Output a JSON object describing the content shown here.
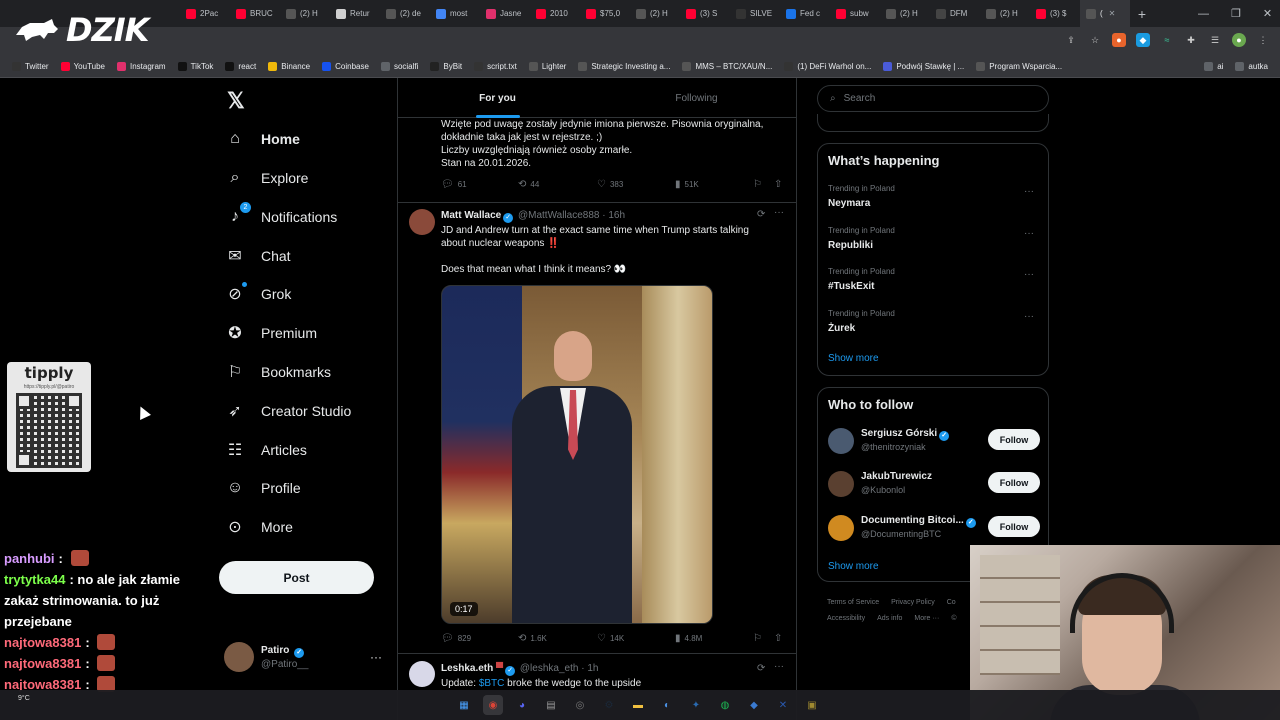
{
  "browser": {
    "tabs": [
      {
        "label": "2Pac",
        "color": "#ff0033",
        "icon": "youtube-icon"
      },
      {
        "label": "BRUC",
        "color": "#ff0033",
        "icon": "youtube-icon"
      },
      {
        "label": "(2) H",
        "color": "#555555",
        "icon": "x-icon"
      },
      {
        "label": "Retur",
        "color": "#d0d0d0",
        "icon": "page-icon"
      },
      {
        "label": "(2) de",
        "color": "#555555",
        "icon": "x-icon"
      },
      {
        "label": "most",
        "color": "#4285f4",
        "icon": "google-icon"
      },
      {
        "label": "Jasne",
        "color": "#e1306c",
        "icon": "instagram-icon"
      },
      {
        "label": "2010",
        "color": "#ff0033",
        "icon": "youtube-icon"
      },
      {
        "label": "$75,0",
        "color": "#ff0033",
        "icon": "youtube-icon"
      },
      {
        "label": "(2) H",
        "color": "#555555",
        "icon": "x-icon"
      },
      {
        "label": "(3) S",
        "color": "#ff0033",
        "icon": "youtube-icon"
      },
      {
        "label": "SILVE",
        "color": "#333333",
        "icon": "tv-icon"
      },
      {
        "label": "Fed c",
        "color": "#1a73e8",
        "icon": "page-icon"
      },
      {
        "label": "subw",
        "color": "#ff0033",
        "icon": "youtube-icon"
      },
      {
        "label": "(2) H",
        "color": "#555555",
        "icon": "x-icon"
      },
      {
        "label": "DFM",
        "color": "#444444",
        "icon": "page-icon"
      },
      {
        "label": "(2) H",
        "color": "#555555",
        "icon": "x-icon"
      },
      {
        "label": "(3) $",
        "color": "#ff0033",
        "icon": "youtube-icon"
      },
      {
        "label": "(",
        "color": "#555555",
        "icon": "x-icon",
        "active": true
      }
    ],
    "new_tab": "+",
    "window_controls": [
      "—",
      "❐",
      "✕"
    ],
    "bookmarks": [
      {
        "label": "Twitter",
        "color": "#333333",
        "icon": "x-icon"
      },
      {
        "label": "YouTube",
        "color": "#ff0033",
        "icon": "youtube-icon"
      },
      {
        "label": "Instagram",
        "color": "#e1306c",
        "icon": "instagram-icon"
      },
      {
        "label": "TikTok",
        "color": "#111111",
        "icon": "tiktok-icon"
      },
      {
        "label": "react",
        "color": "#111111",
        "icon": "tiktok-icon"
      },
      {
        "label": "Binance",
        "color": "#f0b90b",
        "icon": "binance-icon"
      },
      {
        "label": "Coinbase",
        "color": "#1652f0",
        "icon": "coinbase-icon"
      },
      {
        "label": "socialfi",
        "color": "#5f6368",
        "icon": "folder-icon"
      },
      {
        "label": "ByBit",
        "color": "#222222",
        "icon": "bybit-icon"
      },
      {
        "label": "script.txt",
        "color": "#333333",
        "icon": "github-icon"
      },
      {
        "label": "Lighter",
        "color": "#555555",
        "icon": "lighter-icon"
      },
      {
        "label": "Strategic Investing a...",
        "color": "#555555",
        "icon": "loading-icon"
      },
      {
        "label": "MMS – BTC/XAU/N...",
        "color": "#555555",
        "icon": "globe-icon"
      },
      {
        "label": "(1) DeFi Warhol on...",
        "color": "#333333",
        "icon": "x-icon"
      },
      {
        "label": "Podwój Stawkę | ...",
        "color": "#4a5bd8",
        "icon": "page-icon"
      },
      {
        "label": "Program Wsparcia...",
        "color": "#555555",
        "icon": "arrow-icon"
      }
    ],
    "bookmark_folders": [
      "ai",
      "autka"
    ]
  },
  "logo": {
    "text": "DZIK"
  },
  "nav": {
    "items": [
      {
        "label": "Home",
        "icon": "home-icon",
        "active": true
      },
      {
        "label": "Explore",
        "icon": "search-icon"
      },
      {
        "label": "Notifications",
        "icon": "bell-icon",
        "badge": "2"
      },
      {
        "label": "Chat",
        "icon": "mail-icon"
      },
      {
        "label": "Grok",
        "icon": "grok-icon",
        "dot": true
      },
      {
        "label": "Premium",
        "icon": "verified-icon"
      },
      {
        "label": "Bookmarks",
        "icon": "bookmark-icon"
      },
      {
        "label": "Creator Studio",
        "icon": "rocket-icon"
      },
      {
        "label": "Articles",
        "icon": "article-icon"
      },
      {
        "label": "Profile",
        "icon": "person-icon"
      },
      {
        "label": "More",
        "icon": "more-circle-icon"
      }
    ],
    "post_button": "Post",
    "profile": {
      "name": "Patiro",
      "handle": "@Patiro__"
    }
  },
  "timeline": {
    "tabs": [
      "For you",
      "Following"
    ],
    "post1": {
      "lines": [
        "Wzięte pod uwagę zostały jedynie imiona pierwsze. Pisownia oryginalna,",
        "dokładnie taka jak jest w rejestrze. ;)",
        "Liczby uwzględniają również osoby zmarłe.",
        "Stan na 20.01.2026."
      ],
      "stats": {
        "replies": "61",
        "reposts": "44",
        "likes": "383",
        "views": "51K"
      }
    },
    "post2": {
      "name": "Matt Wallace",
      "handle": "@MattWallace888",
      "time": "· 16h",
      "text1": "JD and Andrew turn at the exact same time when Trump starts talking",
      "text2": "about nuclear weapons ‼️",
      "text3": "Does that mean what I think it means? 👀",
      "video_duration": "0:17",
      "stats": {
        "replies": "829",
        "reposts": "1.6K",
        "likes": "14K",
        "views": "4.8M"
      }
    },
    "post3": {
      "name": "Leshka.eth",
      "handle": "@leshka_eth",
      "time": "· 1h",
      "text_prefix": "Update: ",
      "cashtag": "$BTC",
      "text_suffix": " broke the wedge to the upside"
    }
  },
  "right": {
    "search_placeholder": "Search",
    "happening_title": "What’s happening",
    "trends": [
      {
        "context": "Trending in Poland",
        "name": "Neymara"
      },
      {
        "context": "Trending in Poland",
        "name": "Republiki"
      },
      {
        "context": "Trending in Poland",
        "name": "#TuskExit"
      },
      {
        "context": "Trending in Poland",
        "name": "Żurek"
      }
    ],
    "show_more": "Show more",
    "wtf_title": "Who to follow",
    "who_to_follow": [
      {
        "name": "Sergiusz Górski",
        "handle": "@thenitrozyniak",
        "verified": true,
        "avatar_color": "#4a5a70"
      },
      {
        "name": "JakubTurewicz",
        "handle": "@Kubonlol",
        "verified": false,
        "avatar_color": "#5a4030"
      },
      {
        "name": "Documenting Bitcoi...",
        "handle": "@DocumentingBTC",
        "verified": true,
        "avatar_color": "#d08a20"
      }
    ],
    "follow_label": "Follow",
    "footer": {
      "row1": [
        "Terms of Service",
        "Privacy Policy",
        "Co"
      ],
      "row2": [
        "Accessibility",
        "Ads info",
        "More ···",
        "©"
      ]
    }
  },
  "stream": {
    "tipply": {
      "title": "tipply",
      "url": "https://tipply.pl/@patiro"
    },
    "chat": [
      {
        "user": "panhubi",
        "color": "#d89cff",
        "message": "",
        "emote": true
      },
      {
        "user": "trytytka44",
        "color": "#7cff4a",
        "message": "no ale jak złamie zakaż strimowania. to już przejebane",
        "emote": false
      },
      {
        "user": "najtowa8381",
        "color": "#ff6a7a",
        "message": "",
        "emote": true
      },
      {
        "user": "najtowa8381",
        "color": "#ff6a7a",
        "message": "",
        "emote": true
      },
      {
        "user": "najtowa8381",
        "color": "#ff6a7a",
        "message": "",
        "emote": true
      }
    ]
  },
  "taskbar": {
    "weather": "9°C",
    "apps": [
      {
        "icon": "windows-icon",
        "color": "#4aa3ff",
        "glyph": "▦"
      },
      {
        "icon": "chrome-icon",
        "color": "#db4437",
        "glyph": "◉",
        "active": true
      },
      {
        "icon": "discord-icon",
        "color": "#5865f2",
        "glyph": "◕"
      },
      {
        "icon": "task-manager-icon",
        "color": "#999999",
        "glyph": "▤"
      },
      {
        "icon": "obs-icon",
        "color": "#777777",
        "glyph": "◎"
      },
      {
        "icon": "steam-icon",
        "color": "#1b2838",
        "glyph": "⚙"
      },
      {
        "icon": "explorer-icon",
        "color": "#f0c040",
        "glyph": "▬"
      },
      {
        "icon": "app-icon",
        "color": "#4a90e2",
        "glyph": "◐"
      },
      {
        "icon": "app2-icon",
        "color": "#2a6ab0",
        "glyph": "✦"
      },
      {
        "icon": "spotify-icon",
        "color": "#1db954",
        "glyph": "◍"
      },
      {
        "icon": "app3-icon",
        "color": "#3a7ad0",
        "glyph": "◆"
      },
      {
        "icon": "x-app-icon",
        "color": "#2a5ab0",
        "glyph": "✕"
      },
      {
        "icon": "app4-icon",
        "color": "#a08a30",
        "glyph": "▣"
      }
    ]
  }
}
